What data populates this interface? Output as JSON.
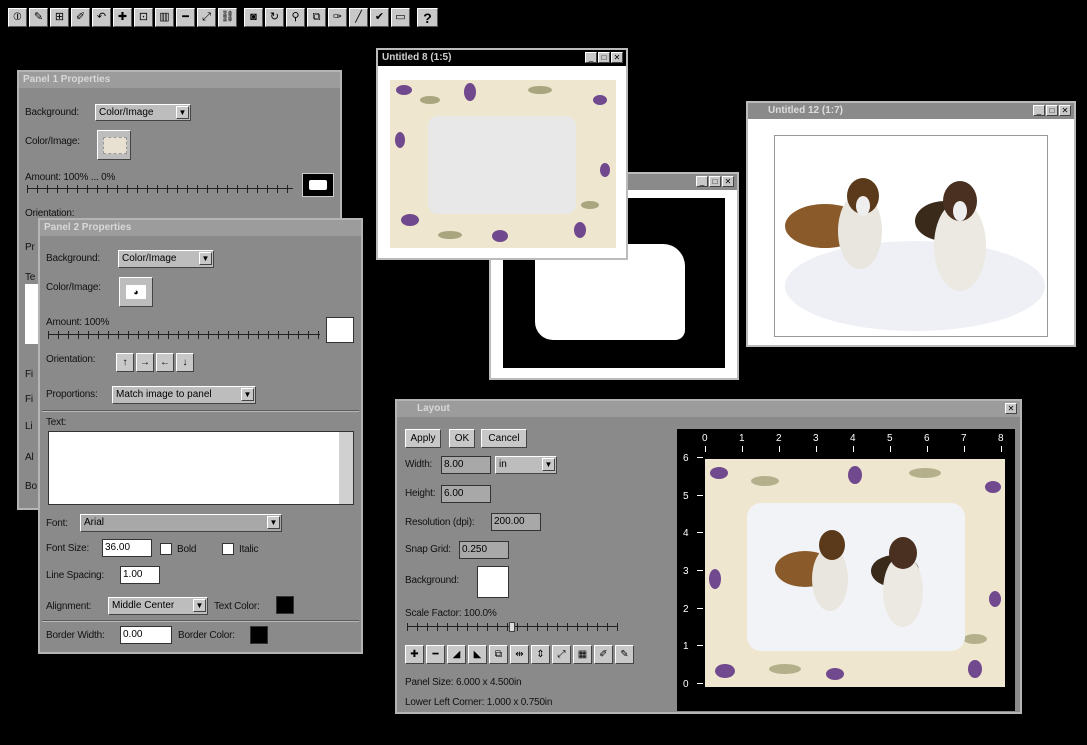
{
  "toolbar": {
    "icons": [
      "panel-icon",
      "edit-panel-icon",
      "grid-icon",
      "text-tool-icon",
      "undo-icon",
      "add-icon",
      "fit-icon",
      "columns-icon",
      "minus-icon",
      "expand-icon",
      "link-icon",
      "frame-icon",
      "rotate-icon",
      "wand-icon",
      "layers-icon",
      "brush-icon",
      "line-icon",
      "pen-icon",
      "image-icon",
      "help-icon"
    ],
    "glyphs": [
      "⦶",
      "✎",
      "⊞",
      "✐",
      "↶",
      "✚",
      "⊡",
      "▥",
      "━",
      "⤢",
      "⛓",
      "◙",
      "↻",
      "⚲",
      "⧉",
      "✑",
      "╱",
      "✔",
      "▭",
      "?"
    ]
  },
  "panel1": {
    "title": "Panel 1 Properties",
    "background_label": "Background:",
    "background_value": "Color/Image",
    "color_image_label": "Color/Image:",
    "amount_label": "Amount: 100% ... 0%",
    "orientation_label": "Orientation:",
    "pr_label": "Pr",
    "te_label": "Te",
    "fi_label": "Fi",
    "fi2_label": "Fi",
    "li_label": "Li",
    "al_label": "Al",
    "bo_label": "Bo"
  },
  "panel2": {
    "title": "Panel 2 Properties",
    "background_label": "Background:",
    "background_value": "Color/Image",
    "color_image_label": "Color/Image:",
    "amount_label": "Amount: 100%",
    "orientation_label": "Orientation:",
    "orientation_arrows": [
      "↑",
      "→",
      "←",
      "↓"
    ],
    "proportions_label": "Proportions:",
    "proportions_value": "Match image to panel",
    "text_label": "Text:",
    "font_label": "Font:",
    "font_value": "Arial",
    "font_size_label": "Font Size:",
    "font_size_value": "36.00",
    "bold_label": "Bold",
    "italic_label": "Italic",
    "line_spacing_label": "Line Spacing:",
    "line_spacing_value": "1.00",
    "alignment_label": "Alignment:",
    "alignment_value": "Middle Center",
    "text_color_label": "Text Color:",
    "border_width_label": "Border Width:",
    "border_width_value": "0.00",
    "border_color_label": "Border Color:"
  },
  "untitled8": {
    "title": "Untitled 8 (1:5)"
  },
  "untitled12": {
    "title": "Untitled 12 (1:7)"
  },
  "mask_window": {
    "title": ""
  },
  "layout": {
    "title": "Layout",
    "apply": "Apply",
    "ok": "OK",
    "cancel": "Cancel",
    "width_label": "Width:",
    "width_value": "8.00",
    "unit_value": "in",
    "height_label": "Height:",
    "height_value": "6.00",
    "resolution_label": "Resolution (dpi):",
    "resolution_value": "200.00",
    "snap_label": "Snap Grid:",
    "snap_value": "0.250",
    "background_label": "Background:",
    "scale_label": "Scale Factor: 100.0%",
    "panel_size": "Panel Size: 6.000 x 4.500in",
    "lower_left": "Lower Left Corner: 1.000 x 0.750in",
    "ruler_x": [
      "0",
      "1",
      "2",
      "3",
      "4",
      "5",
      "6",
      "7",
      "8"
    ],
    "ruler_y": [
      "6",
      "5",
      "4",
      "3",
      "2",
      "1",
      "0"
    ],
    "tool_glyphs": [
      "✚",
      "━",
      "◢",
      "◣",
      "⧉",
      "⇹",
      "⇕",
      "⤢",
      "▦",
      "✐",
      "✎"
    ]
  },
  "colors": {
    "desktop": "#000000",
    "window": "#8a8a8a",
    "accent_purple": "#5a2d82",
    "paper": "#efe6cf"
  }
}
